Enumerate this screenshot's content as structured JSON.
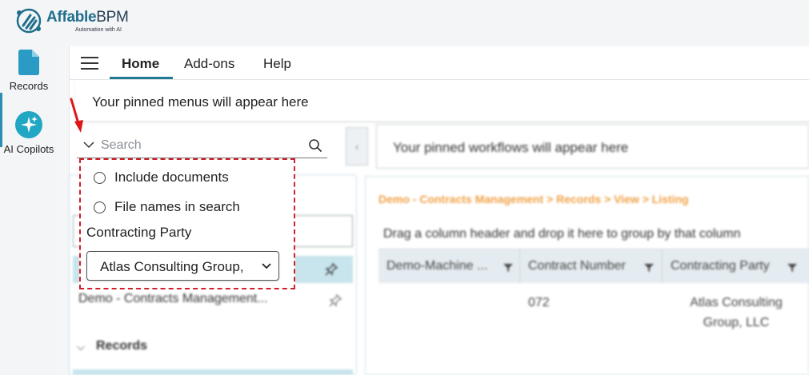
{
  "brand": {
    "name_part1": "Affable",
    "name_part2": "BPM",
    "tagline": "Automation with AI",
    "accent": "#1f6e8c"
  },
  "rail": [
    {
      "label": "Records",
      "icon": "document-icon"
    },
    {
      "label": "AI Copilots",
      "icon": "sparkle-icon"
    }
  ],
  "topnav": {
    "tabs": [
      {
        "label": "Home",
        "active": true
      },
      {
        "label": "Add-ons"
      },
      {
        "label": "Help"
      }
    ]
  },
  "pinned_menus": {
    "text": "Your pinned menus will appear here"
  },
  "search": {
    "placeholder": "Search"
  },
  "search_options": {
    "include_documents": "Include documents",
    "file_names": "File names in search",
    "contracting_party_label": "Contracting Party",
    "contracting_party_value": "Atlas Consulting Group,"
  },
  "left_panel": {
    "item": "Demo - Contracts Management...",
    "section": "Records"
  },
  "workflows": {
    "pinned_text": "Your pinned workflows will appear here",
    "collapse_icon": "chevron-left-icon"
  },
  "grid": {
    "breadcrumb": "Demo - Contracts Management > Records > View > Listing",
    "group_hint": "Drag a column header and drop it here to group by that column",
    "columns": [
      "Demo-Machine ...",
      "Contract Number",
      "Contracting Party"
    ],
    "rows": [
      {
        "contract_number": "072",
        "party_line1": "Atlas Consulting",
        "party_line2": "Group, LLC"
      }
    ]
  },
  "colors": {
    "annotation_red": "#d0202a",
    "breadcrumb_orange": "#f0a043",
    "nav_underline": "#1f7a96"
  }
}
